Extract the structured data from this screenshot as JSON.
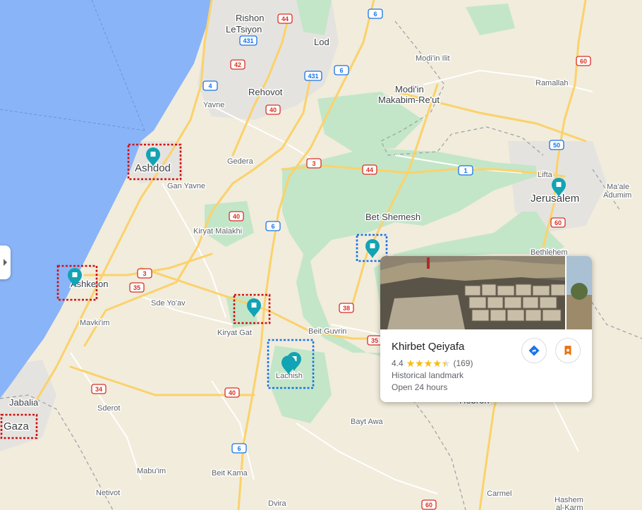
{
  "map": {
    "places": {
      "rishon": "Rishon",
      "letsiyon": "LeTsiyon",
      "lod": "Lod",
      "modiin_ilit": "Modi'in Ilit",
      "rehovot": "Rehovot",
      "yavne": "Yavne",
      "modiin": "Modi'in",
      "makabim": "Makabim-Re'ut",
      "ramallah": "Ramallah",
      "ashdod": "Ashdod",
      "gedera": "Gedera",
      "gan_yavne": "Gan Yavne",
      "lifta": "Lifta",
      "maale_adumim_1": "Ma'ale",
      "maale_adumim_2": "Adumim",
      "jerusalem": "Jerusalem",
      "bet_shemesh": "Bet Shemesh",
      "kiryat_malakhi": "Kiryat Malakhi",
      "bethlehem": "Bethlehem",
      "ashkelon": "Ashkelon",
      "sde_yoav": "Sde Yo'av",
      "mavkiim": "Mavki'im",
      "kiryat_gat": "Kiryat Gat",
      "beit_guvrin": "Beit Guvrin",
      "lachish": "Lachish",
      "jabalia": "Jabalia",
      "gaza": "Gaza",
      "sderot": "Sderot",
      "hebron": "Hebron",
      "bayt_awa": "Bayt Awa",
      "mabuim": "Mabu'im",
      "beit_kama": "Beit Kama",
      "netivot": "Netivot",
      "dvira": "Dvira",
      "carmel": "Carmel",
      "hashem_1": "Hashem",
      "hashem_2": "al-Karm"
    },
    "roads": {
      "r44a": "44",
      "r6a": "6",
      "r431a": "431",
      "r42": "42",
      "r431b": "431",
      "r6b": "6",
      "r4": "4",
      "r40a": "40",
      "r60a": "60",
      "r50": "50",
      "r3a": "3",
      "r44b": "44",
      "r1": "1",
      "r60b": "60",
      "r40b": "40",
      "r6c": "6",
      "r3b": "3",
      "r35a": "35",
      "r38": "38",
      "r35b": "35",
      "r34": "34",
      "r40c": "40",
      "r6d": "6",
      "r60c": "60"
    }
  },
  "panel": {
    "toggle_icon": "chevron-right-icon"
  },
  "card": {
    "title": "Khirbet Qeiyafa",
    "rating": 4.4,
    "rating_text": "4.4",
    "stars": "★★★★★",
    "reviews": "(169)",
    "category": "Historical landmark",
    "hours": "Open 24 hours",
    "directions_icon": "directions-icon",
    "save_icon": "bookmark-icon"
  },
  "colors": {
    "sea": "#8ab4f8",
    "land": "#f1ecdc",
    "park": "#c8e6c9",
    "highway": "#fbd26a",
    "pin": "#12a3b4",
    "highlight_red": "#d1100d",
    "highlight_blue": "#1a73e8",
    "star": "#fbbc04"
  }
}
